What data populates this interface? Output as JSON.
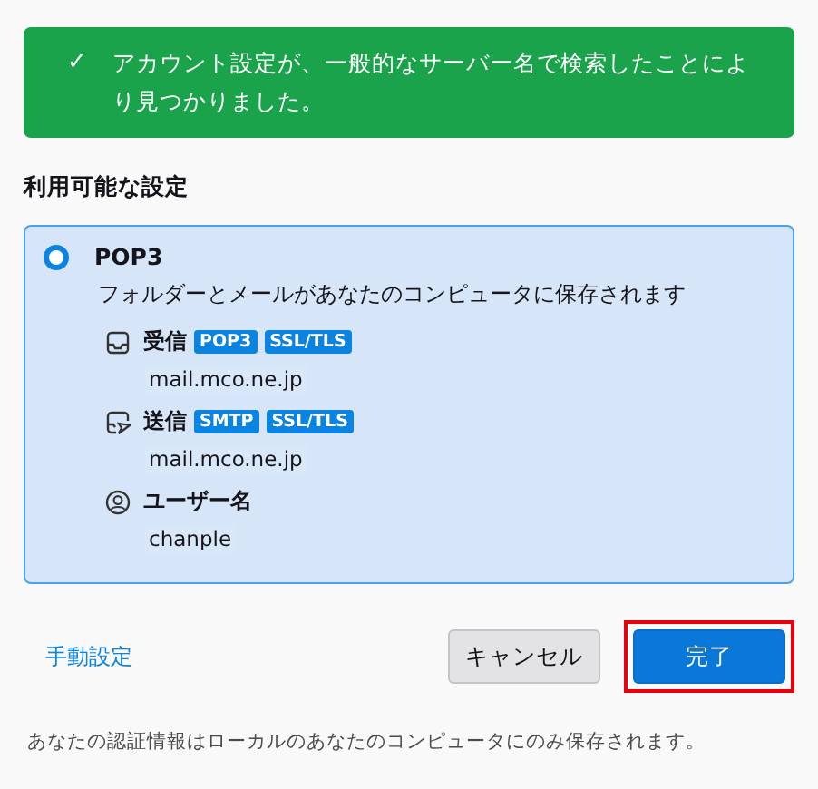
{
  "banner": {
    "icon": "✓",
    "message": "アカウント設定が、一般的なサーバー名で検索したことにより見つかりました。"
  },
  "heading": "利用可能な設定",
  "option": {
    "selected": true,
    "title": "POP3",
    "description": "フォルダーとメールがあなたのコンピュータに保存されます",
    "rows": [
      {
        "kind": "incoming",
        "label": "受信",
        "badges": [
          "POP3",
          "SSL/TLS"
        ],
        "value": "mail.mco.ne.jp"
      },
      {
        "kind": "outgoing",
        "label": "送信",
        "badges": [
          "SMTP",
          "SSL/TLS"
        ],
        "value": "mail.mco.ne.jp"
      },
      {
        "kind": "user",
        "label": "ユーザー名",
        "badges": [],
        "value": "chanple"
      }
    ]
  },
  "manual_link": "手動設定",
  "buttons": [
    {
      "kind": "secondary",
      "label": "キャンセル",
      "highlighted": false
    },
    {
      "kind": "primary",
      "label": "完了",
      "highlighted": true
    }
  ],
  "footer": "あなたの認証情報はローカルのあなたのコンピュータにのみ保存されます。"
}
